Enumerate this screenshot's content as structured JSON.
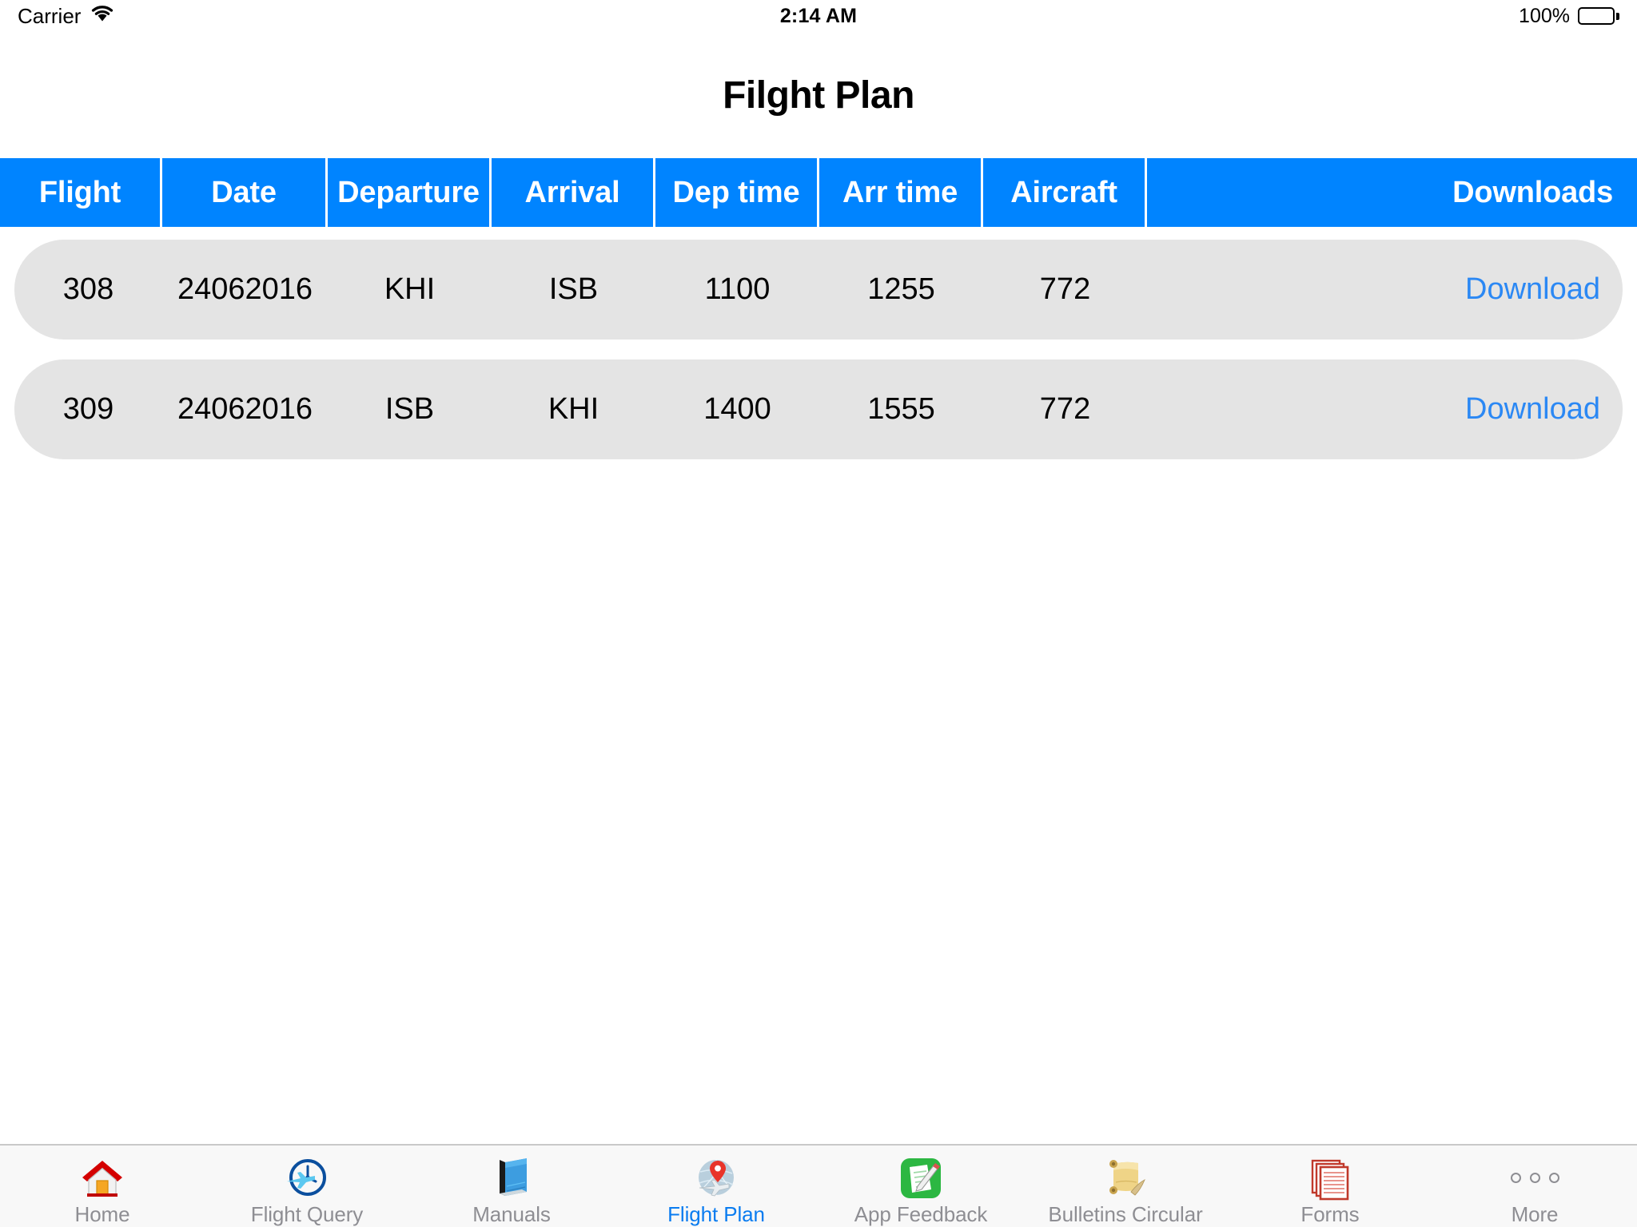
{
  "status_bar": {
    "carrier": "Carrier",
    "wifi_icon": "wifi-icon",
    "time": "2:14 AM",
    "battery_percent": "100%",
    "battery_icon": "battery-full-icon"
  },
  "header": {
    "title": "Filght Plan"
  },
  "theme": {
    "accent_blue": "#0084ff",
    "link_blue": "#2b88f4",
    "row_gray": "#e4e4e4",
    "tab_inactive": "#8e8e93",
    "tab_active": "#0a7cf0"
  },
  "table": {
    "columns": [
      {
        "key": "flight",
        "label": "Flight"
      },
      {
        "key": "date",
        "label": "Date"
      },
      {
        "key": "departure",
        "label": "Departure"
      },
      {
        "key": "arrival",
        "label": "Arrival"
      },
      {
        "key": "dep_time",
        "label": "Dep time"
      },
      {
        "key": "arr_time",
        "label": "Arr time"
      },
      {
        "key": "aircraft",
        "label": "Aircraft"
      },
      {
        "key": "downloads",
        "label": "Downloads"
      }
    ],
    "rows": [
      {
        "flight": "308",
        "date": "24062016",
        "departure": "KHI",
        "arrival": "ISB",
        "dep_time": "1100",
        "arr_time": "1255",
        "aircraft": "772",
        "download_label": "Download"
      },
      {
        "flight": "309",
        "date": "24062016",
        "departure": "ISB",
        "arrival": "KHI",
        "dep_time": "1400",
        "arr_time": "1555",
        "aircraft": "772",
        "download_label": "Download"
      }
    ]
  },
  "tab_bar": {
    "selected_index": 3,
    "items": [
      {
        "label": "Home",
        "icon": "house-icon"
      },
      {
        "label": "Flight Query",
        "icon": "clock-plane-icon"
      },
      {
        "label": "Manuals",
        "icon": "blue-book-icon"
      },
      {
        "label": "Flight Plan",
        "icon": "map-pin-plane-icon"
      },
      {
        "label": "App Feedback",
        "icon": "green-notepad-pencil-icon"
      },
      {
        "label": "Bulletins Circular",
        "icon": "gold-scroll-icon"
      },
      {
        "label": "Forms",
        "icon": "red-documents-stack-icon"
      },
      {
        "label": "More",
        "icon": "three-dots-icon"
      }
    ]
  }
}
